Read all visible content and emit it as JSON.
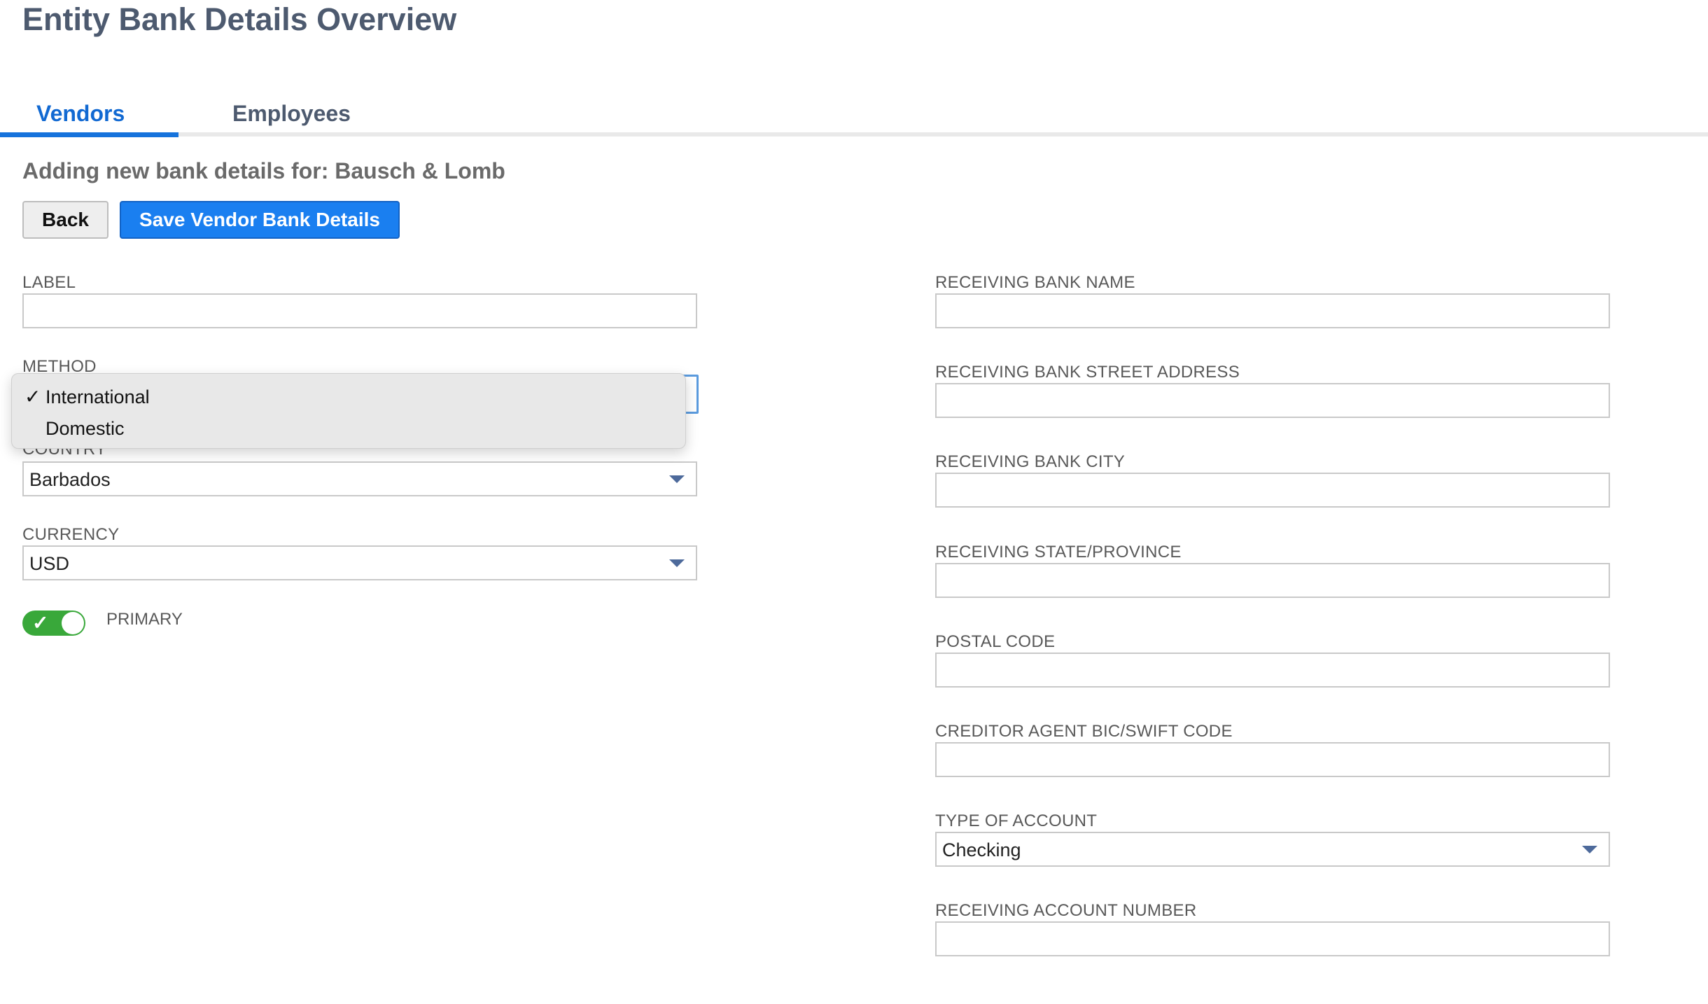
{
  "page": {
    "title": "Entity Bank Details Overview"
  },
  "tabs": [
    {
      "label": "Vendors",
      "active": true
    },
    {
      "label": "Employees",
      "active": false
    }
  ],
  "form": {
    "subtitle": "Adding new bank details for: Bausch & Lomb",
    "back_label": "Back",
    "save_label": "Save Vendor Bank Details",
    "left": {
      "label": {
        "label": "LABEL",
        "value": ""
      },
      "method": {
        "label": "METHOD",
        "options": [
          {
            "label": "International",
            "selected": true,
            "check": "✓"
          },
          {
            "label": "Domestic",
            "selected": false,
            "check": ""
          }
        ]
      },
      "country": {
        "label": "COUNTRY",
        "value": "Barbados"
      },
      "currency": {
        "label": "CURRENCY",
        "value": "USD"
      },
      "primary": {
        "label": "PRIMARY",
        "on": true,
        "check": "✓"
      }
    },
    "right": {
      "bank_name": {
        "label": "RECEIVING BANK NAME",
        "value": ""
      },
      "street": {
        "label": "RECEIVING BANK STREET ADDRESS",
        "value": ""
      },
      "city": {
        "label": "RECEIVING BANK CITY",
        "value": ""
      },
      "state": {
        "label": "RECEIVING STATE/PROVINCE",
        "value": ""
      },
      "postal": {
        "label": "POSTAL CODE",
        "value": ""
      },
      "bic": {
        "label": "CREDITOR AGENT BIC/SWIFT CODE",
        "value": ""
      },
      "account_type": {
        "label": "TYPE OF ACCOUNT",
        "value": "Checking"
      },
      "account_number": {
        "label": "RECEIVING ACCOUNT NUMBER",
        "value": ""
      }
    }
  },
  "colors": {
    "accent": "#1a7ff0",
    "title": "#4d5a6f",
    "toggle_on": "#39a83a",
    "caret": "#4d6a9b"
  }
}
